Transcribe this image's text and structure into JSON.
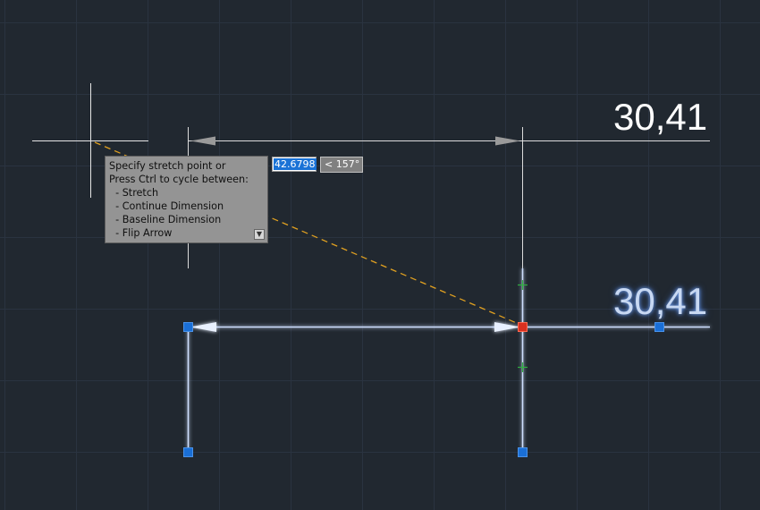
{
  "dimensions": {
    "upper_value": "30,41",
    "lower_value": "30,41"
  },
  "tooltip": {
    "lines": [
      "Specify stretch point or",
      "Press Ctrl to cycle between:",
      "  - Stretch",
      "  - Continue Dimension",
      "  - Baseline Dimension",
      "  - Flip Arrow"
    ]
  },
  "dynamic_input": {
    "distance_value": "42.6798",
    "angle_value": "< 157°"
  },
  "colors": {
    "background": "#212830",
    "grid": "#2a3340",
    "grip": "#1a6fd6",
    "hot_grip": "#d83020",
    "rubber_band": "#e0a020",
    "snap_marker": "#2fb040",
    "selected_glow": "#a8c8ff"
  }
}
